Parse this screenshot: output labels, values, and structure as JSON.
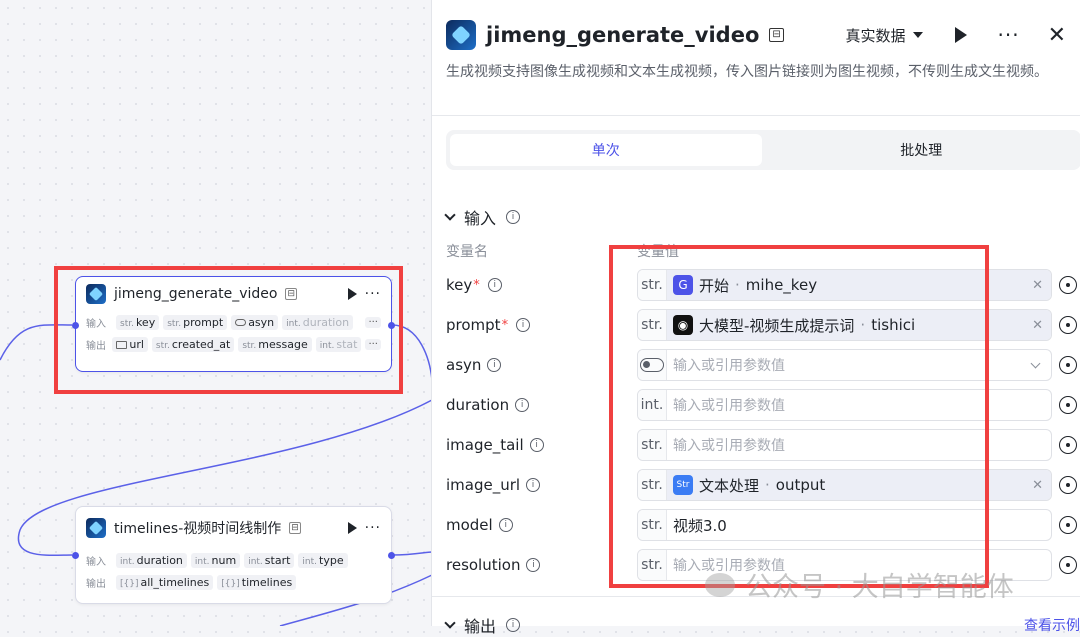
{
  "canvas": {
    "nodes": [
      {
        "title": "jimeng_generate_video",
        "input_label": "输入",
        "output_label": "输出",
        "inputs": [
          {
            "type": "str.",
            "name": "key"
          },
          {
            "type": "str.",
            "name": "prompt"
          },
          {
            "type": "toggle",
            "name": "asyn"
          },
          {
            "type": "int.",
            "name": "duration"
          }
        ],
        "outputs": [
          {
            "type": "folder",
            "name": "url"
          },
          {
            "type": "str.",
            "name": "created_at"
          },
          {
            "type": "str.",
            "name": "message"
          },
          {
            "type": "int.",
            "name": "stat"
          }
        ],
        "more_label": "···"
      },
      {
        "title": "timelines-视频时间线制作",
        "input_label": "输入",
        "output_label": "输出",
        "inputs": [
          {
            "type": "int.",
            "name": "duration"
          },
          {
            "type": "int.",
            "name": "num"
          },
          {
            "type": "int.",
            "name": "start"
          },
          {
            "type": "int.",
            "name": "type"
          }
        ],
        "outputs": [
          {
            "type": "[{}]",
            "name": "all_timelines"
          },
          {
            "type": "[{}]",
            "name": "timelines"
          }
        ]
      }
    ]
  },
  "panel": {
    "title": "jimeng_generate_video",
    "mode": "真实数据",
    "description": "生成视频支持图像生成视频和文本生成视频，传入图片链接则为图生视频，不传则生成文生视频。",
    "tabs": [
      {
        "label": "单次",
        "active": true
      },
      {
        "label": "批处理",
        "active": false
      }
    ],
    "input_section": "输入",
    "col_name": "变量名",
    "col_value": "变量值",
    "placeholder": "输入或引用参数值",
    "params": [
      {
        "name": "key",
        "required": true,
        "type": "str.",
        "kind": "ref",
        "ref_source": "开始",
        "ref_var": "mihe_key",
        "ref_color": "#4d53e8"
      },
      {
        "name": "prompt",
        "required": true,
        "type": "str.",
        "kind": "ref",
        "ref_source": "大模型-视频生成提示词",
        "ref_var": "tishici",
        "ref_color": "#111111"
      },
      {
        "name": "asyn",
        "required": false,
        "type": "toggle",
        "kind": "select"
      },
      {
        "name": "duration",
        "required": false,
        "type": "int.",
        "kind": "empty"
      },
      {
        "name": "image_tail",
        "required": false,
        "type": "str.",
        "kind": "empty"
      },
      {
        "name": "image_url",
        "required": false,
        "type": "str.",
        "kind": "ref",
        "ref_source": "文本处理",
        "ref_var": "output",
        "ref_color": "#3b7cf4"
      },
      {
        "name": "model",
        "required": false,
        "type": "str.",
        "kind": "value",
        "value": "视频3.0"
      },
      {
        "name": "resolution",
        "required": false,
        "type": "str.",
        "kind": "empty"
      }
    ],
    "output_section": "输出",
    "output_link": "查看示例"
  },
  "watermark": "公众号 · 大自学智能体",
  "colors": {
    "accent": "#4d53e8",
    "highlight": "#f04040"
  }
}
